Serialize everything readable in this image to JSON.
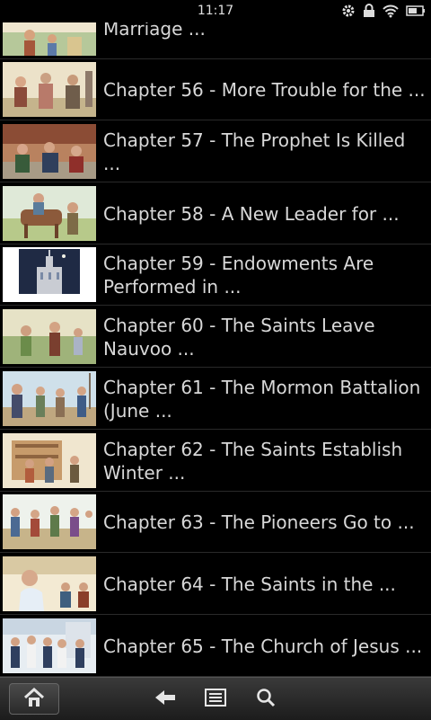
{
  "status_bar": {
    "time": "11:17",
    "icons": [
      "gear-icon",
      "lock-icon",
      "wifi-icon",
      "battery-icon"
    ]
  },
  "chapters": [
    {
      "title": "Marriage ...",
      "thumb": "couple-scene"
    },
    {
      "title": "Chapter 56 - More Trouble for the ...",
      "thumb": "crowd-scene"
    },
    {
      "title": "Chapter 57 - The Prophet Is Killed ...",
      "thumb": "street-scene"
    },
    {
      "title": "Chapter 58 - A New Leader for ...",
      "thumb": "horse-scene"
    },
    {
      "title": "Chapter 59 - Endowments Are Performed in ...",
      "thumb": "temple-night"
    },
    {
      "title": "Chapter 60 - The Saints Leave Nauvoo ...",
      "thumb": "field-scene"
    },
    {
      "title": "Chapter 61 - The Mormon Battalion (June ...",
      "thumb": "battalion-scene"
    },
    {
      "title": "Chapter 62 - The Saints Establish Winter ...",
      "thumb": "building-scene"
    },
    {
      "title": "Chapter 63 - The Pioneers Go to ...",
      "thumb": "dance-scene"
    },
    {
      "title": "Chapter 64 - The Saints in the ...",
      "thumb": "portrait-scene"
    },
    {
      "title": "Chapter 65 - The Church of Jesus ...",
      "thumb": "group-scene"
    }
  ],
  "bottom_bar": {
    "icons": [
      "home-icon",
      "back-arrow-icon",
      "menu-icon",
      "search-icon"
    ]
  }
}
